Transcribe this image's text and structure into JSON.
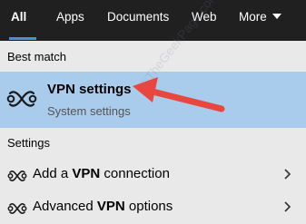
{
  "tabs": [
    {
      "label": "All",
      "active": true
    },
    {
      "label": "Apps"
    },
    {
      "label": "Documents"
    },
    {
      "label": "Web"
    },
    {
      "label": "More"
    }
  ],
  "best_match": {
    "section_label": "Best match",
    "title": "VPN settings",
    "subtitle": "System settings",
    "icon": "vpn-icon"
  },
  "settings": {
    "section_label": "Settings",
    "items": [
      {
        "label_prefix": "Add a ",
        "label_bold": "VPN",
        "label_suffix": " connection",
        "icon": "vpn-icon"
      },
      {
        "label_prefix": "Advanced ",
        "label_bold": "VPN",
        "label_suffix": " options",
        "icon": "vpn-icon"
      }
    ]
  },
  "watermark": "©TheGeekPage.com",
  "colors": {
    "topbar": "#202020",
    "accent": "#4a90d9",
    "selected_row": "#a9cbec",
    "background": "#e9e9e9",
    "arrow": "#e8473f"
  }
}
